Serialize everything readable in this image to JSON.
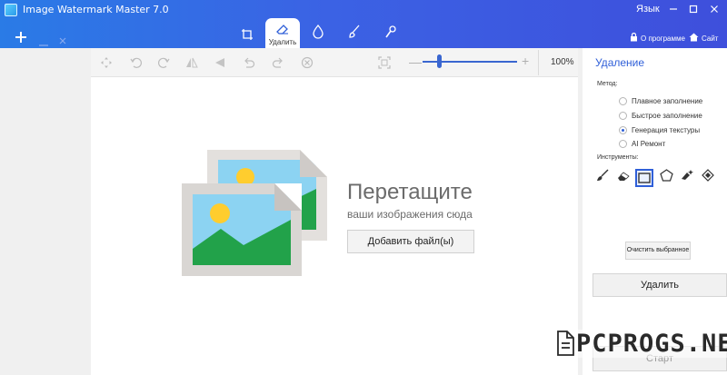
{
  "app": {
    "title": "Image Watermark Master 7.0",
    "language": "Язык",
    "about_label": "О программе",
    "site_label": "Сайт",
    "accent_color": "#2f5fd8",
    "titlebar_gradient": [
      "#2a7be6",
      "#3e4fdc"
    ]
  },
  "window_controls": [
    "minimize-icon",
    "maximize-icon",
    "close-icon"
  ],
  "quick_actions": [
    "plus-icon",
    "minus-icon",
    "close-icon"
  ],
  "mode_tabs": [
    {
      "icon": "crop-icon",
      "label": ""
    },
    {
      "icon": "eraser-icon",
      "label": "Удалить",
      "active": true
    },
    {
      "icon": "drop-icon",
      "label": ""
    },
    {
      "icon": "brush-icon",
      "label": ""
    },
    {
      "icon": "wrench-icon",
      "label": ""
    }
  ],
  "toolbar": {
    "tools": [
      "move-icon",
      "rotate-left-icon",
      "rotate-right-icon",
      "flip-horizontal-icon",
      "flip-vertical-icon",
      "undo-icon",
      "redo-icon",
      "cancel-icon",
      "fit-icon"
    ],
    "zoom_value": "100%",
    "zoom_fraction": 0.15
  },
  "drop_area": {
    "headline": "Перетащите",
    "subline": "ваши изображения сюда",
    "add_button": "Добавить файл(ы)"
  },
  "panel": {
    "title": "Удаление",
    "method_label": "Метод:",
    "methods": [
      {
        "label": "Плавное заполнение",
        "selected": false
      },
      {
        "label": "Быстрое заполнение",
        "selected": false
      },
      {
        "label": "Генерация текстуры",
        "selected": true
      },
      {
        "label": "AI Ремонт",
        "selected": false
      }
    ],
    "tools_label": "Инструменты:",
    "tools": [
      "brush-icon",
      "eraser-icon",
      "rectangle-select-icon",
      "polygon-select-icon",
      "magic-brush-icon",
      "pattern-select-icon"
    ],
    "selected_tool": 2,
    "clear_button": "Очистить выбранное",
    "remove_button": "Удалить",
    "start_button": "Старт"
  },
  "watermark": {
    "text": "PCPROGS.NET"
  }
}
